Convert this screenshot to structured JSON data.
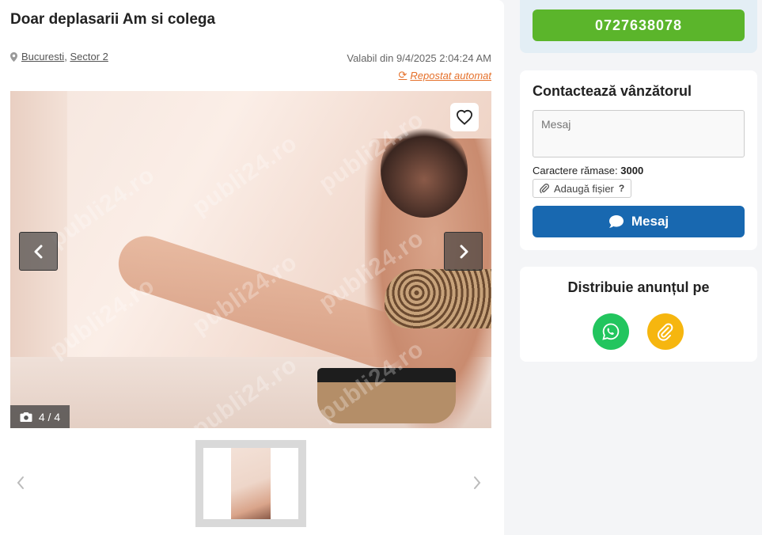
{
  "listing": {
    "title": "Doar deplasarii Am si colega",
    "location_city": "Bucuresti",
    "location_separator": ",",
    "location_sector": "Sector 2",
    "valid_text": "Valabil din 9/4/2025 2:04:24 AM",
    "repost_text": "Repostat automat",
    "watermark": "publi24.ro"
  },
  "gallery": {
    "counter": "4 / 4",
    "current": 4,
    "total": 4
  },
  "phone": {
    "number": "0727638078",
    "color": "#5bb52b"
  },
  "contact": {
    "title": "Contactează vânzătorul",
    "message_placeholder": "Mesaj",
    "chars_label": "Caractere rămase:",
    "chars_value": "3000",
    "attach_label": "Adaugă fișier",
    "attach_help": "?",
    "send_label": "Mesaj",
    "send_color": "#1868b0"
  },
  "share": {
    "title": "Distribuie anunțul pe",
    "buttons": [
      {
        "icon": "whatsapp-icon",
        "color": "#22c55e"
      },
      {
        "icon": "paperclip-icon",
        "color": "#f6b60f"
      }
    ]
  },
  "colors": {
    "accent_orange": "#e5702a",
    "page_bg": "#f4f5f7"
  }
}
